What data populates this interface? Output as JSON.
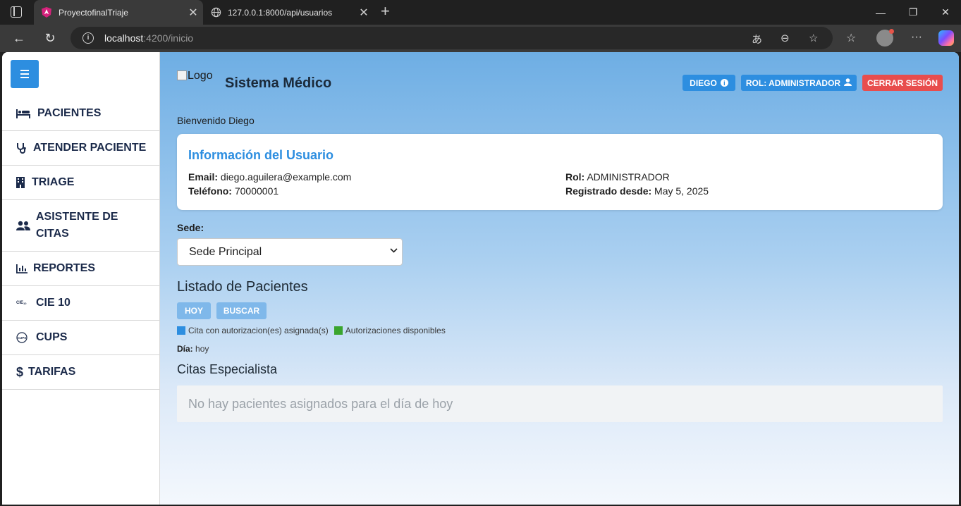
{
  "browser": {
    "tabs": [
      {
        "title": "ProyectofinalTriaje",
        "active": true
      },
      {
        "title": "127.0.0.1:8000/api/usuarios",
        "active": false
      }
    ],
    "url_host": "localhost",
    "url_path": ":4200/inicio"
  },
  "sidebar": {
    "items": [
      {
        "label": "PACIENTES",
        "icon": "bed-icon"
      },
      {
        "label": "ATENDER PACIENTE",
        "icon": "stethoscope-icon"
      },
      {
        "label": "TRIAGE",
        "icon": "building-icon"
      },
      {
        "label": "ASISTENTE DE CITAS",
        "icon": "users-icon"
      },
      {
        "label": "REPORTES",
        "icon": "chart-icon"
      },
      {
        "label": "CIE 10",
        "icon": "cie-icon"
      },
      {
        "label": "CUPS",
        "icon": "cups-icon"
      },
      {
        "label": "TARIFAS",
        "icon": "dollar-icon"
      }
    ]
  },
  "header": {
    "logo_alt": "Logo",
    "title": "Sistema Médico",
    "user_button": "DIEGO",
    "role_button": "ROL: ADMINISTRADOR",
    "logout_button": "CERRAR SESIÓN"
  },
  "welcome": "Bienvenido Diego",
  "user_card": {
    "title": "Información del Usuario",
    "email_label": "Email:",
    "email": "diego.aguilera@example.com",
    "phone_label": "Teléfono:",
    "phone": "70000001",
    "role_label": "Rol:",
    "role": "ADMINISTRADOR",
    "registered_label": "Registrado desde:",
    "registered": "May 5, 2025"
  },
  "sede": {
    "label": "Sede:",
    "selected": "Sede Principal"
  },
  "patients": {
    "heading": "Listado de Pacientes",
    "today_button": "HOY",
    "search_button": "BUSCAR",
    "legend": [
      {
        "label": "Cita con autorizacion(es) asignada(s)",
        "color": "#2d8ee0"
      },
      {
        "label": "Autorizaciones disponibles",
        "color": "#3aa52e"
      }
    ],
    "day_label": "Día:",
    "day_value": "hoy",
    "specialist_heading": "Citas Especialista",
    "empty_message": "No hay pacientes asignados para el día de hoy"
  },
  "colors": {
    "accent": "#2d8ee0",
    "danger": "#e84d4d",
    "sidebar_text": "#1b2a4a"
  }
}
